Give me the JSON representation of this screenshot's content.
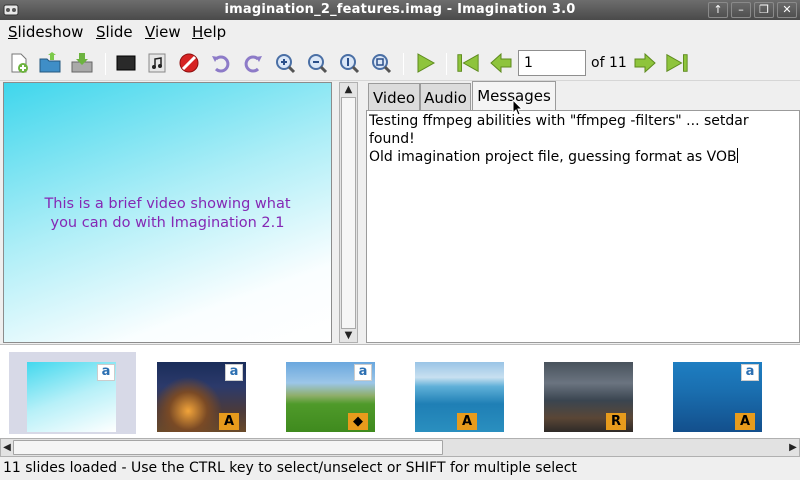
{
  "window": {
    "title": "imagination_2_features.imag - Imagination 3.0",
    "buttons": [
      "↑",
      "–",
      "❐",
      "✕"
    ]
  },
  "menu": [
    "Slideshow",
    "Slide",
    "View",
    "Help"
  ],
  "menu_mnemonics": [
    "S",
    "S",
    "V",
    "H"
  ],
  "toolbar": {
    "slide_number": "1",
    "of_label": "of 11",
    "icons": [
      "new-slideshow-icon",
      "open-slideshow-icon",
      "save-slideshow-icon",
      "add-empty-slide-icon",
      "import-audio-icon",
      "delete-slide-icon",
      "rotate-left-icon",
      "rotate-right-icon",
      "zoom-in-icon",
      "zoom-out-icon",
      "zoom-normal-icon",
      "zoom-fit-icon",
      "play-icon",
      "first-slide-icon",
      "previous-slide-icon",
      "next-slide-icon",
      "last-slide-icon"
    ]
  },
  "preview": {
    "text_line1": "This is a brief video showing what",
    "text_line2": "you can do with Imagination 2.1"
  },
  "tabs": [
    {
      "label": "Video",
      "active": false
    },
    {
      "label": "Audio",
      "active": false
    },
    {
      "label": "Messages",
      "active": true
    }
  ],
  "messages": {
    "line1": "Testing ffmpeg abilities with \"ffmpeg -filters\" ... setdar",
    "line2": "found!",
    "line3": "Old imagination project file, guessing format as VOB"
  },
  "thumbnails": [
    {
      "name": "slide-1",
      "badge": "a",
      "badge2": "",
      "selected": true
    },
    {
      "name": "slide-2",
      "badge": "a",
      "badge2": "A",
      "selected": false
    },
    {
      "name": "slide-3",
      "badge": "a",
      "badge2": "◆",
      "selected": false
    },
    {
      "name": "slide-4",
      "badge": "",
      "badge2": "A",
      "selected": false
    },
    {
      "name": "slide-5",
      "badge": "",
      "badge2": "R",
      "selected": false
    },
    {
      "name": "slide-6",
      "badge": "a",
      "badge2": "A",
      "selected": false
    }
  ],
  "status": "11 slides loaded  - Use the CTRL key to select/unselect or SHIFT for multiple select"
}
